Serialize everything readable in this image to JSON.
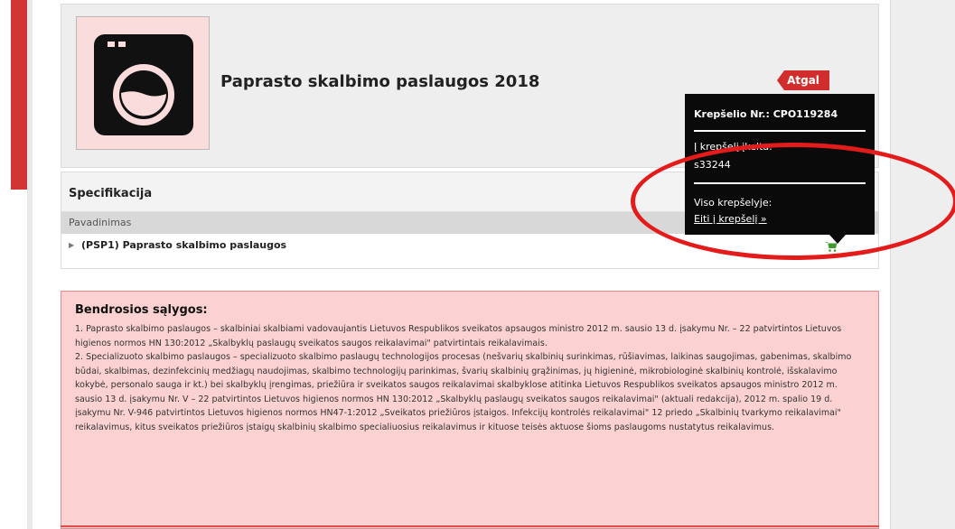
{
  "product": {
    "title": "Paprasto skalbimo paslaugos 2018",
    "back_label": "Atgal",
    "icon": "washing-machine-icon"
  },
  "cart_popup": {
    "cart_number": "Krepšelio Nr.: CPO119284",
    "added_label": "Į krepšelį įkelta:",
    "added_value": "s33244",
    "total_label": "Viso krepšelyje:",
    "go_to_cart": "Eiti į krepšelį »"
  },
  "specification": {
    "title": "Specifikacija",
    "column_header": "Pavadinimas",
    "rows": [
      {
        "label": "(PSP1) Paprasto skalbimo paslaugos"
      }
    ]
  },
  "conditions": {
    "title": "Bendrosios sąlygos:",
    "paragraphs": [
      "1. Paprasto skalbimo paslaugos – skalbiniai skalbiami vadovaujantis Lietuvos Respublikos sveikatos apsaugos ministro 2012 m. sausio 13 d. įsakymu Nr. – 22 patvirtintos Lietuvos higienos normos HN 130:2012 „Skalbyklų paslaugų sveikatos saugos reikalavimai\" patvirtintais reikalavimais.",
      "2. Specializuoto skalbimo paslaugos – specializuoto skalbimo paslaugų technologijos procesas (nešvarių skalbinių surinkimas, rūšiavimas, laikinas saugojimas, gabenimas, skalbimo būdai, skalbimas, dezinfekcinių medžiagų naudojimas, skalbimo technologijų parinkimas, švarių skalbinių grąžinimas, jų higieninė, mikrobiologinė skalbinių kontrolė, išskalavimo kokybė, personalo sauga ir kt.) bei skalbyklų įrengimas, priežiūra ir sveikatos saugos reikalavimai skalbyklose atitinka Lietuvos Respublikos sveikatos apsaugos ministro 2012 m. sausio 13 d. įsakymu Nr. V – 22 patvirtintos Lietuvos higienos normos HN 130:2012 „Skalbyklų paslaugų sveikatos saugos reikalavimai\" (aktuali redakcija), 2012 m. spalio 19 d. įsakymu Nr. V-946 patvirtintos Lietuvos higienos normos HN47-1:2012 „Sveikatos priežiūros įstaigos. Infekcijų kontrolės reikalavimai\" 12 priedo „Skalbinių tvarkymo reikalavimai\" reikalavimus, kitus sveikatos priežiūros įstaigų skalbinių skalbimo specialiuosius reikalavimus ir kituose teisės aktuose šioms paslaugoms nustatytus reikalavimus."
    ]
  },
  "colors": {
    "accent_red": "#d22d2d",
    "popup_bg": "#0a0a0a",
    "conditions_bg": "#fbd1d1",
    "annotation_red": "#e41b1b",
    "cart_green": "#3e9a2c"
  }
}
